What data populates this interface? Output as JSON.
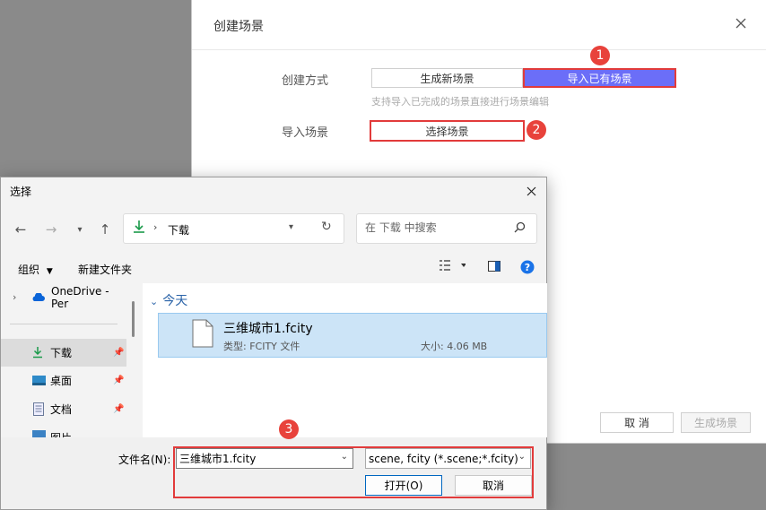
{
  "web_dialog": {
    "title": "创建场景",
    "create_method_label": "创建方式",
    "tabs": [
      "生成新场景",
      "导入已有场景"
    ],
    "hint": "支持导入已完成的场景直接进行场景编辑",
    "import_label": "导入场景",
    "choose_button": "选择场景",
    "cancel_button": "取 消",
    "generate_button": "生成场景"
  },
  "badges": [
    "1",
    "2",
    "3"
  ],
  "file_dialog": {
    "title": "选择",
    "address": "下载",
    "search_placeholder": "在 下载 中搜索",
    "toolbar": {
      "organize": "组织",
      "new_folder": "新建文件夹"
    },
    "nav_items": [
      {
        "label": "OneDrive - Per",
        "icon": "cloud-icon"
      },
      {
        "label": "下载",
        "icon": "download-icon"
      },
      {
        "label": "桌面",
        "icon": "desktop-icon"
      },
      {
        "label": "文档",
        "icon": "document-icon"
      },
      {
        "label": "图片",
        "icon": "picture-icon"
      }
    ],
    "group_header": "今天",
    "file": {
      "name": "三维城市1.fcity",
      "type": "类型: FCITY 文件",
      "size": "大小: 4.06 MB"
    },
    "filename_label": "文件名(N):",
    "filename_value": "三维城市1.fcity",
    "filter_value": "scene, fcity (*.scene;*.fcity)",
    "open_button": "打开(O)",
    "cancel_button": "取消"
  },
  "colors": {
    "accent": "#6b6ef8",
    "highlight": "#e23b3b",
    "selected_row": "#cce4f7"
  }
}
